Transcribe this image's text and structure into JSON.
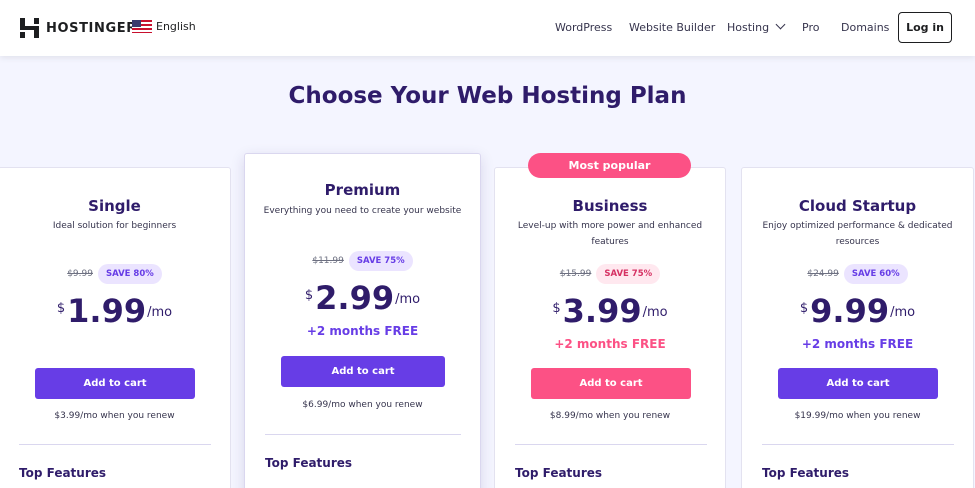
{
  "header": {
    "logo_text": "HOSTINGER",
    "language": "English",
    "nav": [
      "WordPress",
      "Website Builder",
      "Hosting",
      "Pro",
      "Domains"
    ],
    "login_label": "Log in"
  },
  "page_title": "Choose Your Web Hosting Plan",
  "popular_badge": "Most popular",
  "plans": [
    {
      "name": "Single",
      "desc_lines": [
        "Ideal solution for beginners"
      ],
      "old_price": "$9.99",
      "save": "SAVE 80%",
      "currency": "$",
      "price": "1.99",
      "per": "/mo",
      "bonus": "",
      "cta": "Add to cart",
      "renew": "$3.99/mo when you renew",
      "features_heading": "Top Features"
    },
    {
      "name": "Premium",
      "desc_lines": [
        "Everything you need to create your website"
      ],
      "old_price": "$11.99",
      "save": "SAVE 75%",
      "currency": "$",
      "price": "2.99",
      "per": "/mo",
      "bonus": "+2 months FREE",
      "cta": "Add to cart",
      "renew": "$6.99/mo when you renew",
      "features_heading": "Top Features"
    },
    {
      "name": "Business",
      "desc_lines": [
        "Level-up with more power and enhanced",
        "features"
      ],
      "old_price": "$15.99",
      "save": "SAVE 75%",
      "currency": "$",
      "price": "3.99",
      "per": "/mo",
      "bonus": "+2 months FREE",
      "cta": "Add to cart",
      "renew": "$8.99/mo when you renew",
      "features_heading": "Top Features"
    },
    {
      "name": "Cloud Startup",
      "desc_lines": [
        "Enjoy optimized performance & dedicated",
        "resources"
      ],
      "old_price": "$24.99",
      "save": "SAVE 60%",
      "currency": "$",
      "price": "9.99",
      "per": "/mo",
      "bonus": "+2 months FREE",
      "cta": "Add to cart",
      "renew": "$19.99/mo when you renew",
      "features_heading": "Top Features"
    }
  ],
  "colors": {
    "brand_purple": "#673de6",
    "brand_pink": "#fc5185",
    "heading": "#2f1c6a",
    "page_bg": "#f4f5ff"
  },
  "icons": [
    "hostinger-logo-icon",
    "us-flag-icon",
    "chevron-down-icon"
  ]
}
